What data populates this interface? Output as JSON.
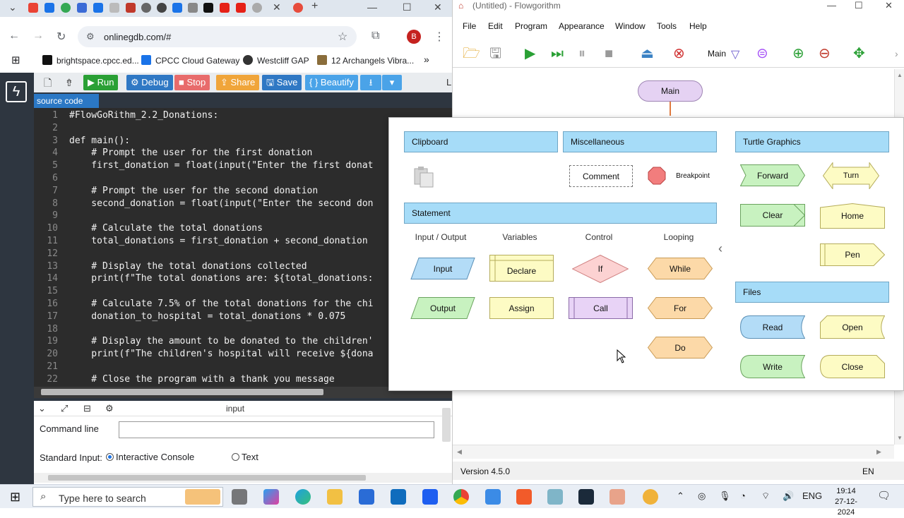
{
  "browser": {
    "url": "onlinegdb.com/#",
    "profile_initial": "B",
    "bookmarks": [
      "brightspace.cpcc.ed...",
      "CPCC Cloud Gateway",
      "Westcliff GAP",
      "12 Archangels Vibra..."
    ],
    "bookmarks_more": "»"
  },
  "gdb": {
    "toolbar": {
      "run": "▶ Run",
      "debug": "⚙ Debug",
      "stop": "■ Stop",
      "share": "⇪ Share",
      "save": "🖫 Save",
      "beautify": "{ } Beautify",
      "download": "⭳",
      "more": "▾",
      "cut_label": "L"
    },
    "source_tab": "source code",
    "lines": [
      {
        "n": "1",
        "text": "#FlowGoRithm_2.2_Donations:"
      },
      {
        "n": "2",
        "text": ""
      },
      {
        "n": "3",
        "text": "def main():"
      },
      {
        "n": "4",
        "text": "    # Prompt the user for the first donation"
      },
      {
        "n": "5",
        "text": "    first_donation = float(input(\"Enter the first donat"
      },
      {
        "n": "6",
        "text": ""
      },
      {
        "n": "7",
        "text": "    # Prompt the user for the second donation"
      },
      {
        "n": "8",
        "text": "    second_donation = float(input(\"Enter the second don"
      },
      {
        "n": "9",
        "text": ""
      },
      {
        "n": "10",
        "text": "    # Calculate the total donations"
      },
      {
        "n": "11",
        "text": "    total_donations = first_donation + second_donation"
      },
      {
        "n": "12",
        "text": ""
      },
      {
        "n": "13",
        "text": "    # Display the total donations collected"
      },
      {
        "n": "14",
        "text": "    print(f\"The total donations are: ${total_donations:"
      },
      {
        "n": "15",
        "text": ""
      },
      {
        "n": "16",
        "text": "    # Calculate 7.5% of the total donations for the chi"
      },
      {
        "n": "17",
        "text": "    donation_to_hospital = total_donations * 0.075"
      },
      {
        "n": "18",
        "text": ""
      },
      {
        "n": "19",
        "text": "    # Display the amount to be donated to the children'"
      },
      {
        "n": "20",
        "text": "    print(f\"The children's hospital will receive ${dona"
      },
      {
        "n": "21",
        "text": ""
      },
      {
        "n": "22",
        "text": "    # Close the program with a thank you message"
      }
    ],
    "io": {
      "title": "input",
      "command_line_label": "Command line",
      "command_line_value": "",
      "stdin_label": "Standard Input:",
      "opt_interactive": "Interactive Console",
      "opt_text": "Text",
      "selected": "Interactive Console"
    }
  },
  "flowgorithm": {
    "title": "(Untitled) - Flowgorithm",
    "menu": [
      "File",
      "Edit",
      "Program",
      "Appearance",
      "Window",
      "Tools",
      "Help"
    ],
    "function_select": "Main",
    "main_node": "Main",
    "version": "Version 4.5.0",
    "lang": "EN",
    "palette": {
      "clipboard": "Clipboard",
      "miscellaneous": "Miscellaneous",
      "comment": "Comment",
      "breakpoint": "Breakpoint",
      "statement": "Statement",
      "columns": [
        "Input / Output",
        "Variables",
        "Control",
        "Looping"
      ],
      "input": "Input",
      "output": "Output",
      "declare": "Declare",
      "assign": "Assign",
      "if": "If",
      "call": "Call",
      "while": "While",
      "for": "For",
      "do": "Do",
      "turtle": "Turtle Graphics",
      "forward": "Forward",
      "turn": "Turn",
      "clear": "Clear",
      "home": "Home",
      "pen": "Pen",
      "files": "Files",
      "read": "Read",
      "open": "Open",
      "write": "Write",
      "close": "Close"
    }
  },
  "taskbar": {
    "search_placeholder": "Type here to search",
    "lang": "ENG",
    "time": "19:14",
    "date": "27-12-2024"
  },
  "colors": {
    "gdb_run": "#2aa035",
    "gdb_debug": "#2f78c4",
    "gdb_stop": "#e74c3c",
    "gdb_share": "#f0a53a",
    "palette_header": "#a6dcf8",
    "io_shape": "#b3dcf7",
    "output_shape": "#c8f2c0",
    "var_shape": "#fdfbc4",
    "if_shape": "#fcd2d2",
    "call_shape": "#e8d3f6",
    "loop_shape": "#fcd9a8"
  }
}
